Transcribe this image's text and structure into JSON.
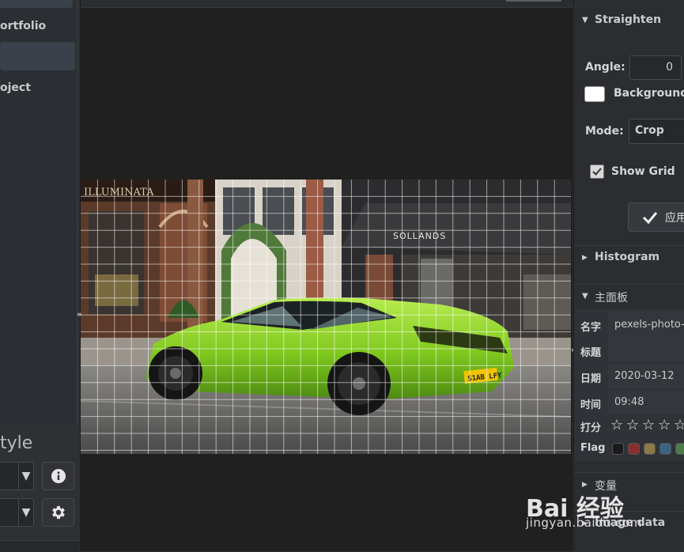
{
  "left_panel": {
    "items": [
      {
        "label": "ortfolio",
        "selected": false
      },
      {
        "label": "",
        "selected": true
      },
      {
        "label": "oject",
        "selected": false
      }
    ],
    "style_title": "tyle",
    "dropdown_1_value": "",
    "dropdown_2_value": "",
    "info_icon": "info-icon",
    "settings_icon": "gear-icon"
  },
  "straighten": {
    "title": "Straighten",
    "angle_label": "Angle:",
    "angle_value": "0",
    "background_label": "Background",
    "background_color": "#ffffff",
    "mode_label": "Mode:",
    "mode_value": "Crop",
    "show_grid_label": "Show Grid",
    "show_grid_checked": true,
    "apply_label": "应用"
  },
  "histogram": {
    "title": "Histogram"
  },
  "main_panel": {
    "title": "主面板",
    "name_label": "名字",
    "name_value": "pexels-photo-",
    "title_label": "标题",
    "title_value": "",
    "date_label": "日期",
    "date_value": "2020-03-12",
    "time_label": "时间",
    "time_value": "09:48",
    "rating_label": "打分",
    "rating": 0,
    "flag_label": "Flag",
    "flag_colors": [
      "#1a1a1a",
      "#8a2f2f",
      "#8a7a48",
      "#3c6482",
      "#4e7a4b"
    ]
  },
  "variables": {
    "title": "变量"
  },
  "image_data": {
    "title": "Image data"
  },
  "photo": {
    "plate_text": "S1AB LFY",
    "sign_text": "SOLLANDS",
    "store_text": "ILLUMINATA"
  },
  "watermark": {
    "logo": "Bai 经验",
    "url": "jingyan.baidu.com"
  }
}
